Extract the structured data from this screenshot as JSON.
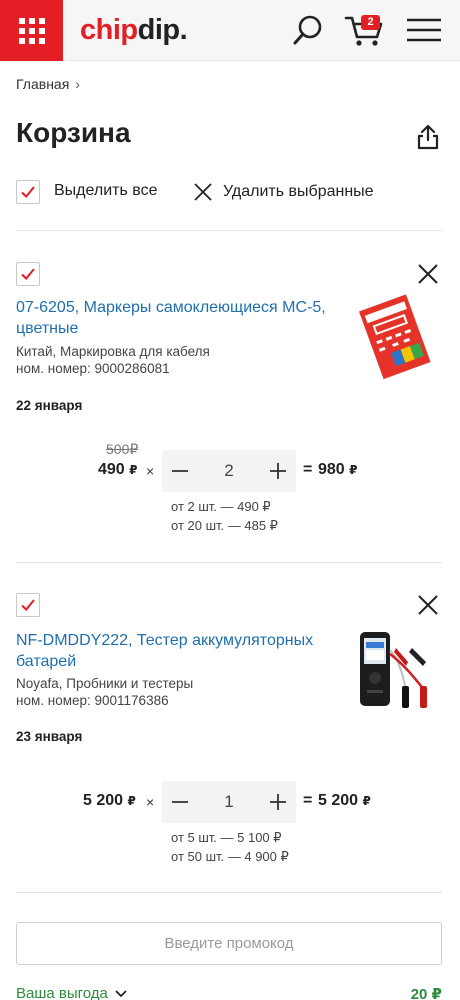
{
  "header": {
    "logo_part1": "chip",
    "logo_part2": "dip.",
    "cart_count": "2",
    "icons": [
      "grid-icon",
      "search-icon",
      "cart-icon",
      "menu-icon"
    ],
    "brand_color": "#e31e24"
  },
  "breadcrumb": {
    "home": "Главная",
    "separator": "›"
  },
  "page": {
    "title": "Корзина",
    "select_all": "Выделить все",
    "delete_selected": "Удалить выбранные"
  },
  "items": [
    {
      "title": "07-6205, Маркеры самоклеющиеся МС-5, цветные",
      "meta_line1": "Китай, Маркировка для кабеля",
      "meta_line2": "ном. номер: 9000286081",
      "date": "22 января",
      "old_price": "500",
      "old_currency": "₽",
      "price": "490",
      "currency": "₽",
      "times": "×",
      "qty": "2",
      "equals": "=",
      "total": "980",
      "tiers": [
        "от 2 шт. — 490 ₽",
        "от 20 шт. — 485 ₽"
      ],
      "checked": true
    },
    {
      "title": "NF-DMDDY222, Тестер аккумуляторных батарей",
      "meta_line1": "Noyafa, Пробники и тестеры",
      "meta_line2": "ном. номер: 9001176386",
      "date": "23 января",
      "price": "5 200",
      "currency": "₽",
      "times": "×",
      "qty": "1",
      "equals": "=",
      "total": "5 200",
      "tiers": [
        "от 5 шт. — 5 100 ₽",
        "от 50 шт. — 4 900 ₽"
      ],
      "checked": true
    }
  ],
  "promo": {
    "placeholder": "Введите промокод"
  },
  "savings": {
    "label": "Ваша выгода",
    "value": "20 ₽",
    "color": "#2e8b3d"
  }
}
